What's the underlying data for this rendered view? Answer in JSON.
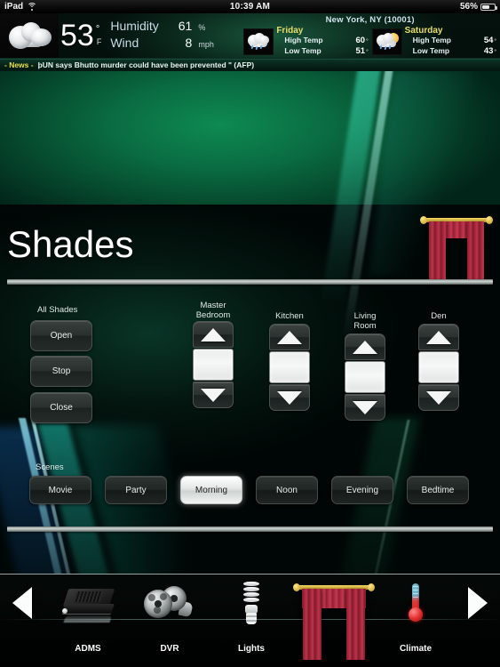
{
  "status_bar": {
    "device": "iPad",
    "wifi_icon": "wifi-icon",
    "time": "10:39 AM",
    "battery_percent": "56%",
    "battery_icon": "battery-icon"
  },
  "weather": {
    "current_icon": "cloudy-icon",
    "temperature": "53",
    "degree_symbol": "°",
    "unit": "F",
    "humidity_label": "Humidity",
    "humidity_value": "61",
    "humidity_unit": "%",
    "wind_label": "Wind",
    "wind_value": "8",
    "wind_unit": "mph",
    "location": "New York, NY (10001)",
    "forecast": [
      {
        "day": "Friday",
        "icon": "rain-cloud-icon",
        "high_label": "High Temp",
        "high_value": "60",
        "low_label": "Low Temp",
        "low_value": "51",
        "degree": "°"
      },
      {
        "day": "Saturday",
        "icon": "sun-cloud-rain-icon",
        "high_label": "High Temp",
        "high_value": "54",
        "low_label": "Low Temp",
        "low_value": "43",
        "degree": "°"
      }
    ]
  },
  "news": {
    "tag": "- News -",
    "headline": "þUN says Bhutto murder could have been prevented \" (AFP)"
  },
  "page": {
    "title": "Shades",
    "header_icon": "curtain-icon"
  },
  "all_shades": {
    "label": "All Shades",
    "buttons": [
      {
        "label": "Open"
      },
      {
        "label": "Stop"
      },
      {
        "label": "Close"
      }
    ]
  },
  "rooms": [
    {
      "name": "Master\nBedroom",
      "line1": "Master",
      "line2": "Bedroom",
      "up_icon": "arrow-up-icon",
      "down_icon": "arrow-down-icon"
    },
    {
      "name": "Kitchen",
      "line1": "Kitchen",
      "line2": "",
      "up_icon": "arrow-up-icon",
      "down_icon": "arrow-down-icon"
    },
    {
      "name": "Living Room",
      "line1": "Living Room",
      "line2": "",
      "up_icon": "arrow-up-icon",
      "down_icon": "arrow-down-icon"
    },
    {
      "name": "Den",
      "line1": "Den",
      "line2": "",
      "up_icon": "arrow-up-icon",
      "down_icon": "arrow-down-icon"
    }
  ],
  "scenes": {
    "label": "Scenes",
    "active": "Morning",
    "items": [
      {
        "label": "Movie",
        "active": false
      },
      {
        "label": "Party",
        "active": false
      },
      {
        "label": "Morning",
        "active": true
      },
      {
        "label": "Noon",
        "active": false
      },
      {
        "label": "Evening",
        "active": false
      },
      {
        "label": "Bedtime",
        "active": false
      }
    ]
  },
  "nav": {
    "prev_icon": "arrow-left-icon",
    "next_icon": "arrow-right-icon",
    "items": [
      {
        "label": "ADMS",
        "icon": "av-receiver-icon"
      },
      {
        "label": "DVR",
        "icon": "film-reel-icon"
      },
      {
        "label": "Lights",
        "icon": "cfl-bulb-icon"
      },
      {
        "label": "",
        "icon": "curtain-icon",
        "selected": true
      },
      {
        "label": "Climate",
        "icon": "thermometer-icon"
      }
    ]
  },
  "colors": {
    "accent_green": "#0e8a52",
    "header_dark": "#021009",
    "highlight_white": "#ffffff",
    "news_yellow": "#e8e04a",
    "curtain_red": "#9e2036",
    "rod_gold": "#f3d96a"
  }
}
